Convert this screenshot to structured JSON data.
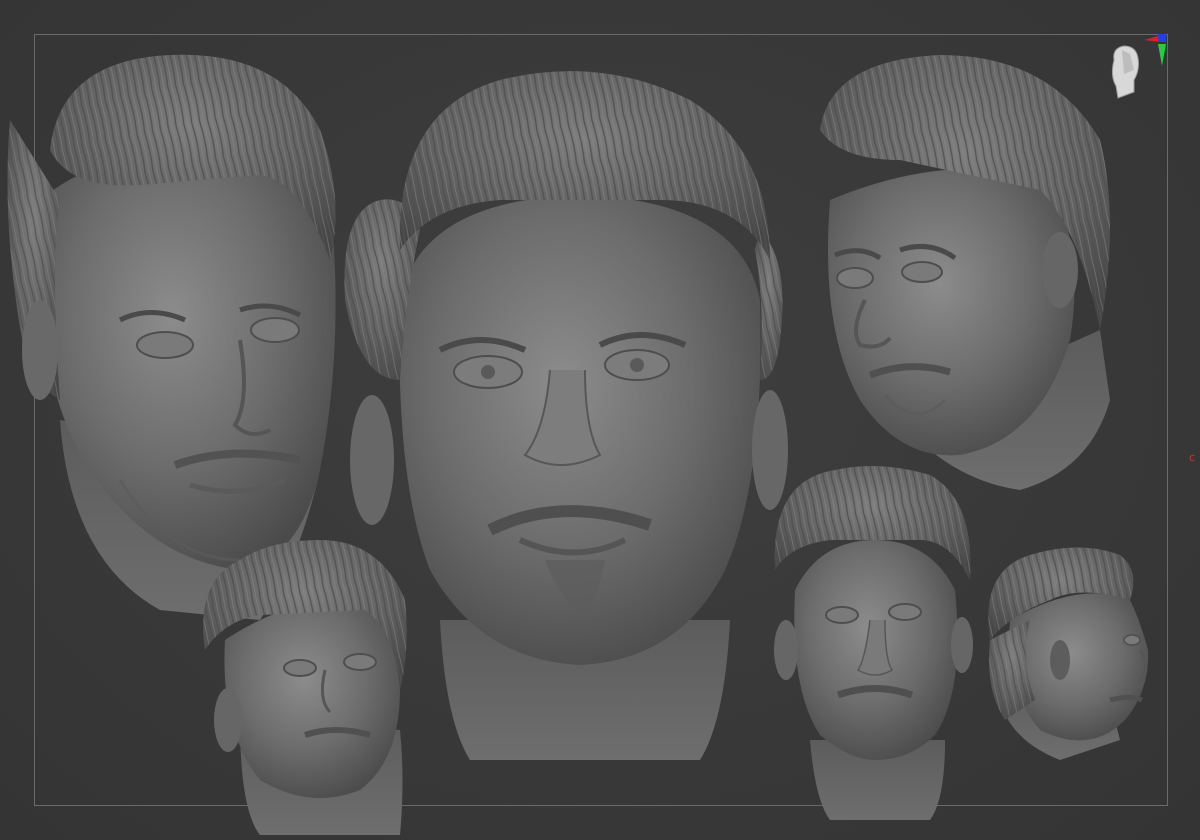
{
  "viewport": {
    "background": "#3a3a3a",
    "frame_color": "#6a6a6a"
  },
  "sculpt": {
    "clay_base": "#6b6b6b",
    "clay_light": "#8a8a8a",
    "clay_dark": "#4a4a4a",
    "views": [
      {
        "name": "three-quarter-left-large"
      },
      {
        "name": "front-center"
      },
      {
        "name": "three-quarter-right"
      },
      {
        "name": "three-quarter-left-small"
      },
      {
        "name": "front-small"
      },
      {
        "name": "profile-right"
      }
    ]
  },
  "navigator": {
    "icon": "head-navigator-icon",
    "axis_colors": {
      "x": "#e02020",
      "y": "#20d040",
      "z": "#2040e0"
    }
  },
  "edge_marker": {
    "text": "c",
    "color": "#c83a3a"
  }
}
